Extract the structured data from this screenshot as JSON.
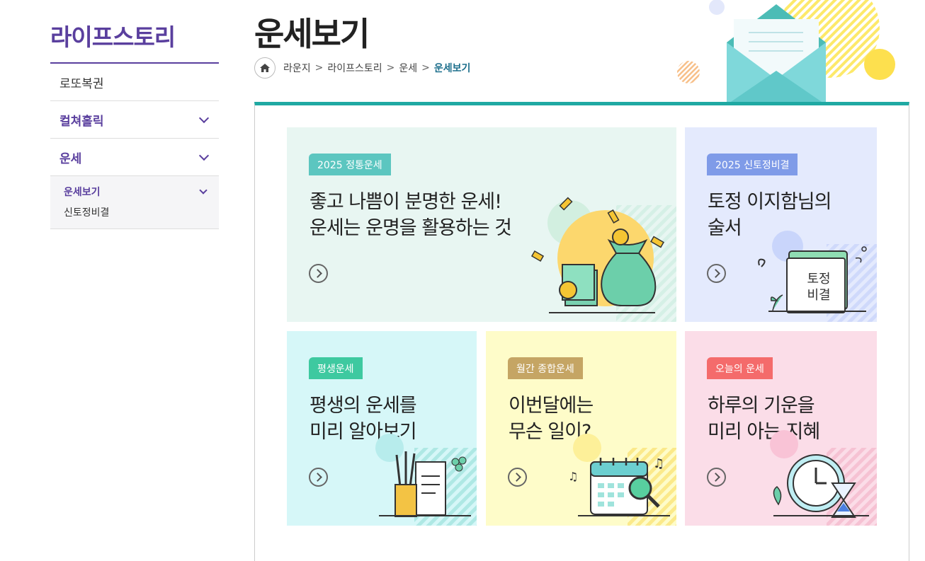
{
  "sidebar": {
    "title": "라이프스토리",
    "items": [
      {
        "label": "로또복권"
      },
      {
        "label": "컬쳐홀릭"
      },
      {
        "label": "운세"
      }
    ],
    "sub": {
      "active": "운세보기",
      "link": "신토정비결"
    }
  },
  "header": {
    "title": "운세보기",
    "breadcrumb": [
      "라운지",
      "라이프스토리",
      "운세",
      "운세보기"
    ]
  },
  "cards": [
    {
      "badge": "2025 정통운세",
      "line1": "좋고 나쁨이 분명한 운세!",
      "line2": "운세는 운명을 활용하는 것",
      "bg": "#e8f6f2",
      "badge_color": "#5cc6c0"
    },
    {
      "badge": "2025 신토정비결",
      "line1": "토정 이지함님의",
      "line2": "술서",
      "bg": "#e4eafd",
      "badge_color": "#7f9be8",
      "book_line1": "토정",
      "book_line2": "비결"
    },
    {
      "badge": "평생운세",
      "line1": "평생의 운세를",
      "line2": "미리 알아보기",
      "bg": "#d6f7f8",
      "badge_color": "#3ec9a0"
    },
    {
      "badge": "월간 종합운세",
      "line1": "이번달에는",
      "line2": "무슨 일이?",
      "bg": "#fefcc9",
      "badge_color": "#c5a564"
    },
    {
      "badge": "오늘의 운세",
      "line1": "하루의 기운을",
      "line2": "미리 아는 지혜",
      "bg": "#fbdde8",
      "badge_color": "#f46b6b"
    }
  ],
  "colors": {
    "accent": "#5a3f9e",
    "teal": "#1fa9a3",
    "crumb_current": "#1d6f8c"
  },
  "icons": [
    "home-icon",
    "chevron-down-icon",
    "arrow-right-icon",
    "envelope-icon"
  ]
}
